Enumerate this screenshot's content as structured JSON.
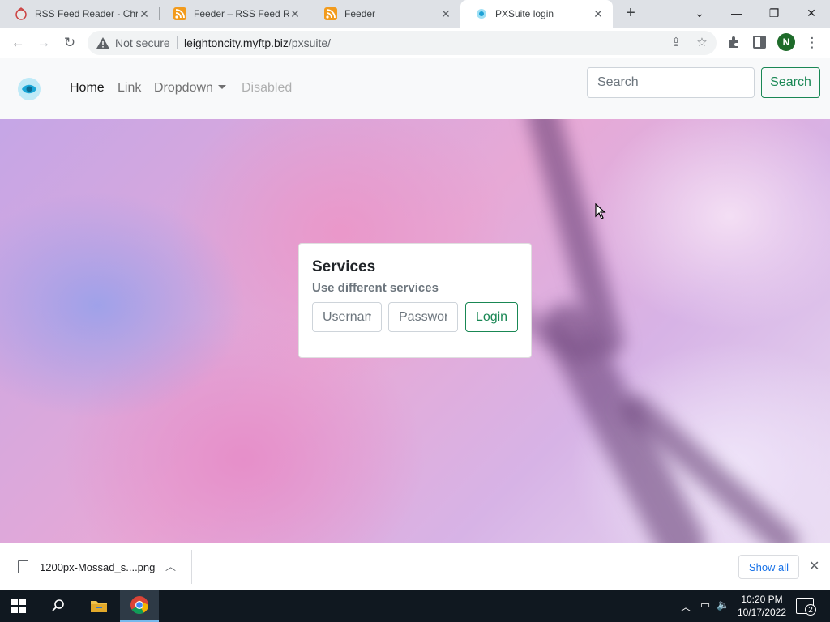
{
  "browser": {
    "tabs": [
      {
        "title": "RSS Feed Reader - Chr",
        "icon": "rss-reader-extension-icon",
        "active": false
      },
      {
        "title": "Feeder – RSS Feed Rea",
        "icon": "rss-icon",
        "active": false
      },
      {
        "title": "Feeder",
        "icon": "rss-icon",
        "active": false
      },
      {
        "title": "PXSuite login",
        "icon": "pxsuite-favicon",
        "active": true
      }
    ],
    "new_tab_label": "+",
    "security_label": "Not secure",
    "url_host": "leightoncity.myftp.biz",
    "url_path": "/pxsuite/",
    "profile_initial": "N"
  },
  "navbar": {
    "links": [
      {
        "label": "Home",
        "state": "active"
      },
      {
        "label": "Link",
        "state": "normal"
      },
      {
        "label": "Dropdown",
        "state": "dropdown"
      },
      {
        "label": "Disabled",
        "state": "disabled"
      }
    ],
    "search_placeholder": "Search",
    "search_button": "Search"
  },
  "login_card": {
    "title": "Services",
    "subtitle": "Use different services",
    "username_placeholder": "Username",
    "password_placeholder": "Password",
    "login_button": "Login"
  },
  "downloads": {
    "file_name": "1200px-Mossad_s....png",
    "show_all": "Show all"
  },
  "taskbar": {
    "time": "10:20 PM",
    "date": "10/17/2022",
    "notification_count": "2"
  },
  "colors": {
    "success": "#198754",
    "chrome_tabstrip": "#dee1e6",
    "navbar_bg": "#f8f9fa",
    "taskbar_bg": "#101820"
  }
}
